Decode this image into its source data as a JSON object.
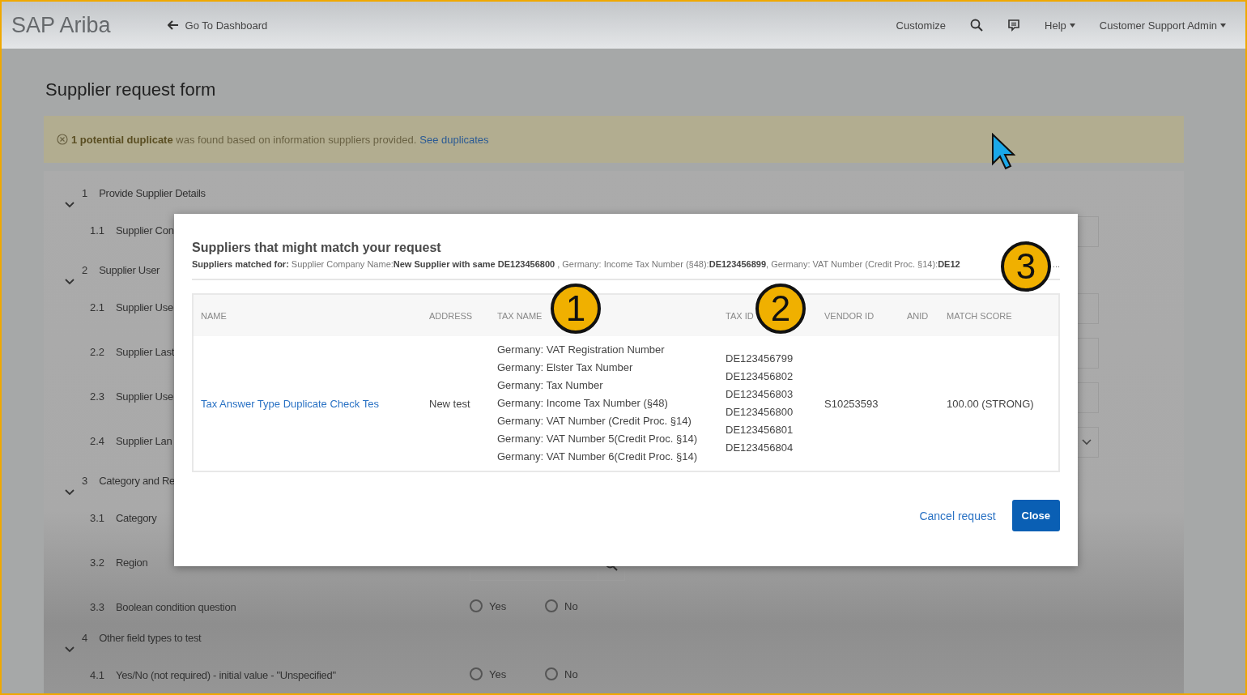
{
  "header": {
    "logo": "SAP Ariba",
    "back_link": "Go To Dashboard",
    "nav": [
      {
        "kind": "link",
        "label": "Customize"
      },
      {
        "kind": "search"
      },
      {
        "kind": "chat"
      },
      {
        "kind": "menu",
        "label": "Help"
      },
      {
        "kind": "menu",
        "label": "Customer Support Admin"
      }
    ]
  },
  "page": {
    "title": "Supplier request form"
  },
  "banner": {
    "text": "**1 potential duplicate** was found based on information suppliers provided.",
    "link": "See duplicates"
  },
  "form": {
    "sections": [
      {
        "number": "1",
        "title": "Provide Supplier Details",
        "expanded": true,
        "items": [
          {
            "number": "1.1",
            "label": "Supplier Con",
            "kind": "text"
          }
        ]
      },
      {
        "number": "2",
        "title": "Supplier User",
        "expanded": true,
        "items": [
          {
            "number": "2.1",
            "label": "Supplier Use",
            "kind": "text"
          },
          {
            "number": "2.2",
            "label": "Supplier Last",
            "kind": "text"
          },
          {
            "number": "2.3",
            "label": "Supplier Use",
            "kind": "text"
          },
          {
            "number": "2.4",
            "label": "Supplier Lan",
            "kind": "select"
          }
        ]
      },
      {
        "number": "3",
        "title": "Category and Re",
        "expanded": true,
        "items": [
          {
            "number": "3.1",
            "label": "Category",
            "kind": "plain"
          },
          {
            "number": "3.2",
            "label": "Region",
            "kind": "search"
          },
          {
            "number": "3.3",
            "label": "Boolean condition question",
            "kind": "radio",
            "options": [
              {
                "label": "Yes",
                "selected": false
              },
              {
                "label": "No",
                "selected": false
              }
            ]
          }
        ]
      },
      {
        "number": "4",
        "title": "Other field types to test",
        "expanded": true,
        "items": [
          {
            "number": "4.1",
            "label": "Yes/No (not required) - initial value - \"Unspecified\"",
            "kind": "radio",
            "options": [
              {
                "label": "Yes",
                "selected": false
              },
              {
                "label": "No",
                "selected": false
              }
            ]
          }
        ]
      }
    ]
  },
  "modal": {
    "title": "Suppliers that might match your request",
    "subtitle": "**Suppliers matched for:** Supplier Company Name:**New Supplier with same DE123456800** , Germany: Income Tax Number (§48):**DE123456899**, Germany: VAT Number (Credit Proc. §14):**DE12**",
    "ellipsis": "...",
    "table": {
      "columns": [
        "NAME",
        "ADDRESS",
        "TAX NAME",
        "TAX ID",
        "VENDOR ID",
        "ANID",
        "MATCH SCORE"
      ],
      "rows": [
        {
          "name": "Tax Answer Type Duplicate Check Tes",
          "address": "New test",
          "tax_name": [
            "Germany: VAT Registration Number",
            "Germany: Elster Tax Number",
            "Germany: Tax Number",
            "Germany: Income Tax Number (§48)",
            "Germany: VAT Number (Credit Proc. §14)",
            "Germany: VAT Number 5(Credit Proc. §14)",
            "Germany: VAT Number 6(Credit Proc. §14)"
          ],
          "tax_id": [
            "DE123456799",
            "DE123456802",
            "DE123456803",
            "DE123456800",
            "DE123456801",
            "DE123456804"
          ],
          "vendor_id": "S10253593",
          "match_score": "100.00 (STRONG)"
        }
      ]
    },
    "actions": [
      {
        "kind": "link",
        "label": "Cancel request"
      },
      {
        "kind": "primary",
        "label": "Close"
      }
    ]
  },
  "callouts": [
    "1",
    "2",
    "3"
  ]
}
